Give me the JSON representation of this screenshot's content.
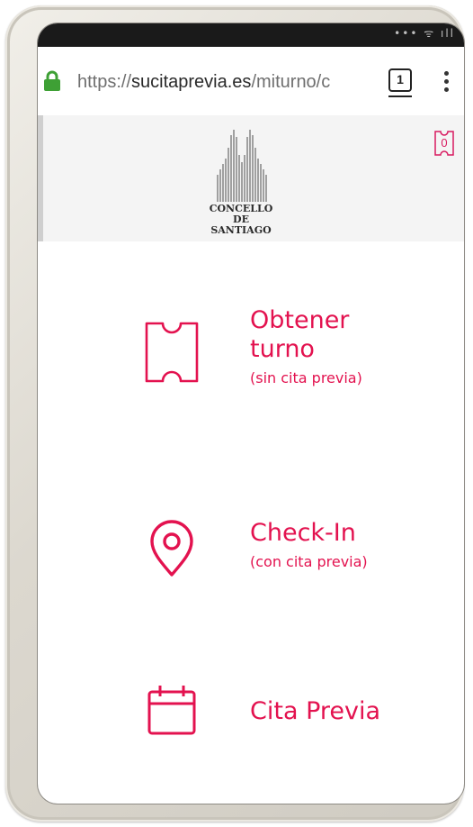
{
  "browser": {
    "url_prefix": "https://",
    "url_domain": "sucitaprevia.es",
    "url_path": "/miturno/c",
    "tab_count": "1"
  },
  "header": {
    "logo_text": "CONCELLO DE\nSANTIAGO",
    "ticket_count": "0"
  },
  "menu": {
    "items": [
      {
        "icon": "ticket-icon",
        "title": "Obtener\nturno",
        "subtitle": "(sin cita previa)"
      },
      {
        "icon": "location-pin-icon",
        "title": "Check-In",
        "subtitle": "(con cita previa)"
      },
      {
        "icon": "calendar-icon",
        "title": "Cita Previa",
        "subtitle": ""
      }
    ]
  },
  "colors": {
    "accent": "#e3124f",
    "lock": "#3ea035",
    "header_bg": "#f4f4f4"
  }
}
